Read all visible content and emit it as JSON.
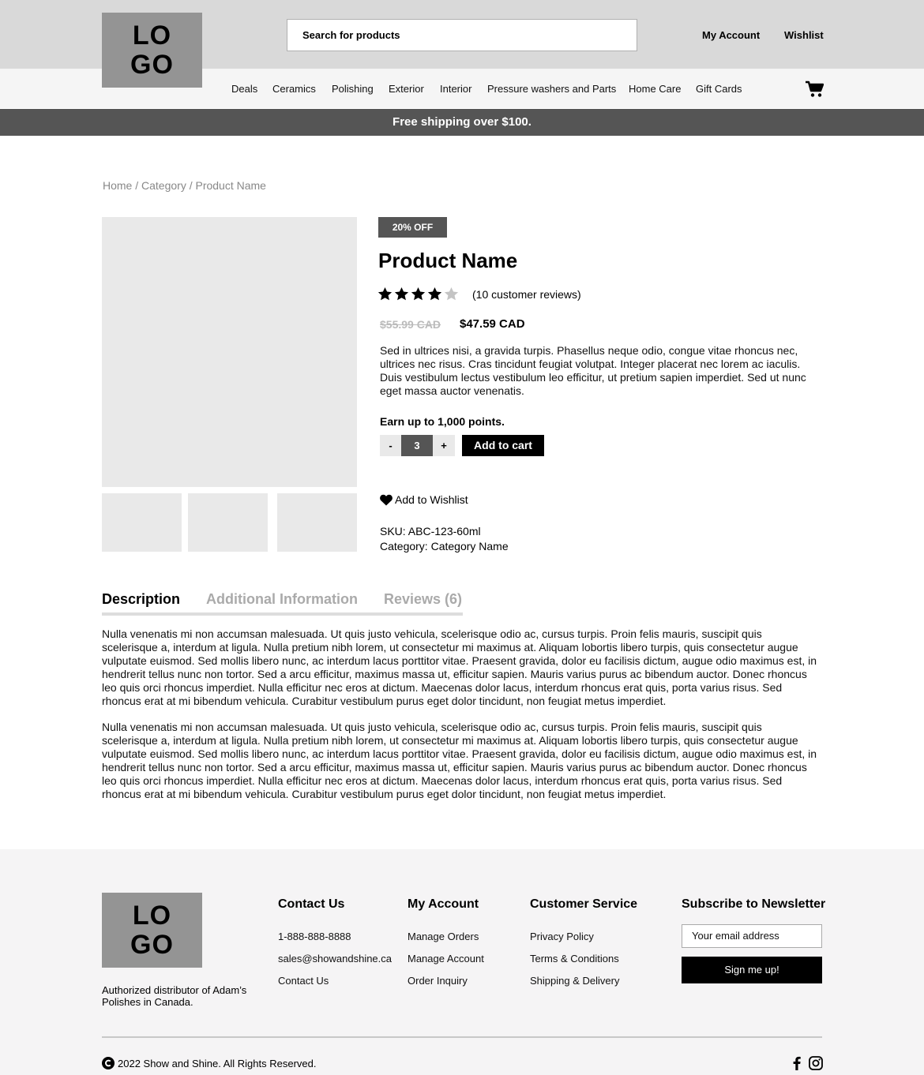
{
  "header": {
    "logo_line1": "LO",
    "logo_line2": "GO",
    "search_placeholder": "Search for products",
    "top_links": [
      "My Account",
      "Wishlist"
    ],
    "nav_items": [
      "Deals",
      "Ceramics",
      "Polishing",
      "Exterior",
      "Interior",
      "Pressure washers and Parts",
      "Home Care",
      "Gift Cards"
    ],
    "cart_icon": "shopping-cart-icon"
  },
  "promo": {
    "text": "Free shipping over $100."
  },
  "breadcrumb": {
    "text": "Home / Category / Product Name",
    "items": [
      "Home",
      "Category",
      "Product Name"
    ]
  },
  "product": {
    "badge": "20% OFF",
    "name": "Product Name",
    "rating": 4,
    "rating_max": 5,
    "reviews_text": "(10 customer reviews)",
    "old_price": "$55.99 CAD",
    "new_price": "$47.59 CAD",
    "description": "Sed in ultrices nisi, a gravida turpis. Phasellus neque odio, congue vitae rhoncus nec, ultrices nec risus. Cras tincidunt feugiat volutpat. Integer placerat nec lorem ac iaculis. Duis vestibulum lectus vestibulum leo efficitur, ut pretium sapien imperdiet. Sed ut nunc eget massa auctor venenatis.",
    "points": "Earn up to 1,000 points.",
    "qty_minus": "-",
    "quantity": "3",
    "qty_plus": "+",
    "add_to_cart": "Add to cart",
    "wishlist": "Add to Wishlist",
    "sku": "SKU: ABC-123-60ml",
    "category": "Category: Category Name",
    "thumbnail_count": 3
  },
  "tabs": {
    "items": [
      "Description",
      "Additional Information",
      "Reviews (6)"
    ],
    "active": "Description",
    "paragraphs": [
      "Nulla venenatis mi non accumsan malesuada. Ut quis justo vehicula, scelerisque odio ac, cursus turpis. Proin felis mauris, suscipit quis scelerisque a, interdum at ligula. Nulla pretium nibh lorem, ut consectetur mi maximus at. Aliquam lobortis libero turpis, quis consectetur augue vulputate euismod. Sed mollis libero nunc, ac interdum lacus porttitor vitae. Praesent gravida, dolor eu facilisis dictum, augue odio maximus est, in hendrerit tellus nunc non tortor. Sed a arcu efficitur, maximus massa ut, efficitur sapien. Mauris varius purus ac bibendum auctor. Donec rhoncus leo quis orci rhoncus imperdiet. Nulla efficitur nec eros at dictum. Maecenas dolor lacus, interdum rhoncus erat quis, porta varius risus. Sed rhoncus erat at mi bibendum vehicula. Curabitur vestibulum purus eget dolor tincidunt, non feugiat metus imperdiet.",
      "Nulla venenatis mi non accumsan malesuada. Ut quis justo vehicula, scelerisque odio ac, cursus turpis. Proin felis mauris, suscipit quis scelerisque a, interdum at ligula. Nulla pretium nibh lorem, ut consectetur mi maximus at. Aliquam lobortis libero turpis, quis consectetur augue vulputate euismod. Sed mollis libero nunc, ac interdum lacus porttitor vitae. Praesent gravida, dolor eu facilisis dictum, augue odio maximus est, in hendrerit tellus nunc non tortor. Sed a arcu efficitur, maximus massa ut, efficitur sapien. Mauris varius purus ac bibendum auctor. Donec rhoncus leo quis orci rhoncus imperdiet. Nulla efficitur nec eros at dictum. Maecenas dolor lacus, interdum rhoncus erat quis, porta varius risus. Sed rhoncus erat at mi bibendum vehicula. Curabitur vestibulum purus eget dolor tincidunt, non feugiat metus imperdiet."
    ]
  },
  "footer": {
    "logo_line1": "LO",
    "logo_line2": "GO",
    "tagline": "Authorized distributor of Adam’s Polishes in Canada.",
    "columns": [
      {
        "heading": "Contact Us",
        "links": [
          "1-888-888-8888",
          "sales@showandshine.ca",
          "Contact Us"
        ]
      },
      {
        "heading": "My Account",
        "links": [
          "Manage Orders",
          "Manage Account",
          "Order Inquiry"
        ]
      },
      {
        "heading": "Customer Service",
        "links": [
          "Privacy Policy",
          "Terms & Conditions",
          "Shipping & Delivery"
        ]
      }
    ],
    "newsletter": {
      "heading": "Subscribe to Newsletter",
      "email_placeholder": "Your email address",
      "button": "Sign me up!"
    },
    "copyright": "2022 Show and Shine. All Rights Reserved.",
    "social_icons": [
      "facebook-icon",
      "instagram-icon"
    ]
  },
  "colors": {
    "topbar": "#d9d9d9",
    "navbar": "#f5f5f5",
    "promo_bar": "#555555",
    "logo_bg": "#949494",
    "placeholder_img": "#e9e9e9",
    "primary_button": "#000000",
    "muted_text": "#888888",
    "inactive_tab": "#aaaaaa",
    "footer_bg": "#f5f4f5"
  }
}
